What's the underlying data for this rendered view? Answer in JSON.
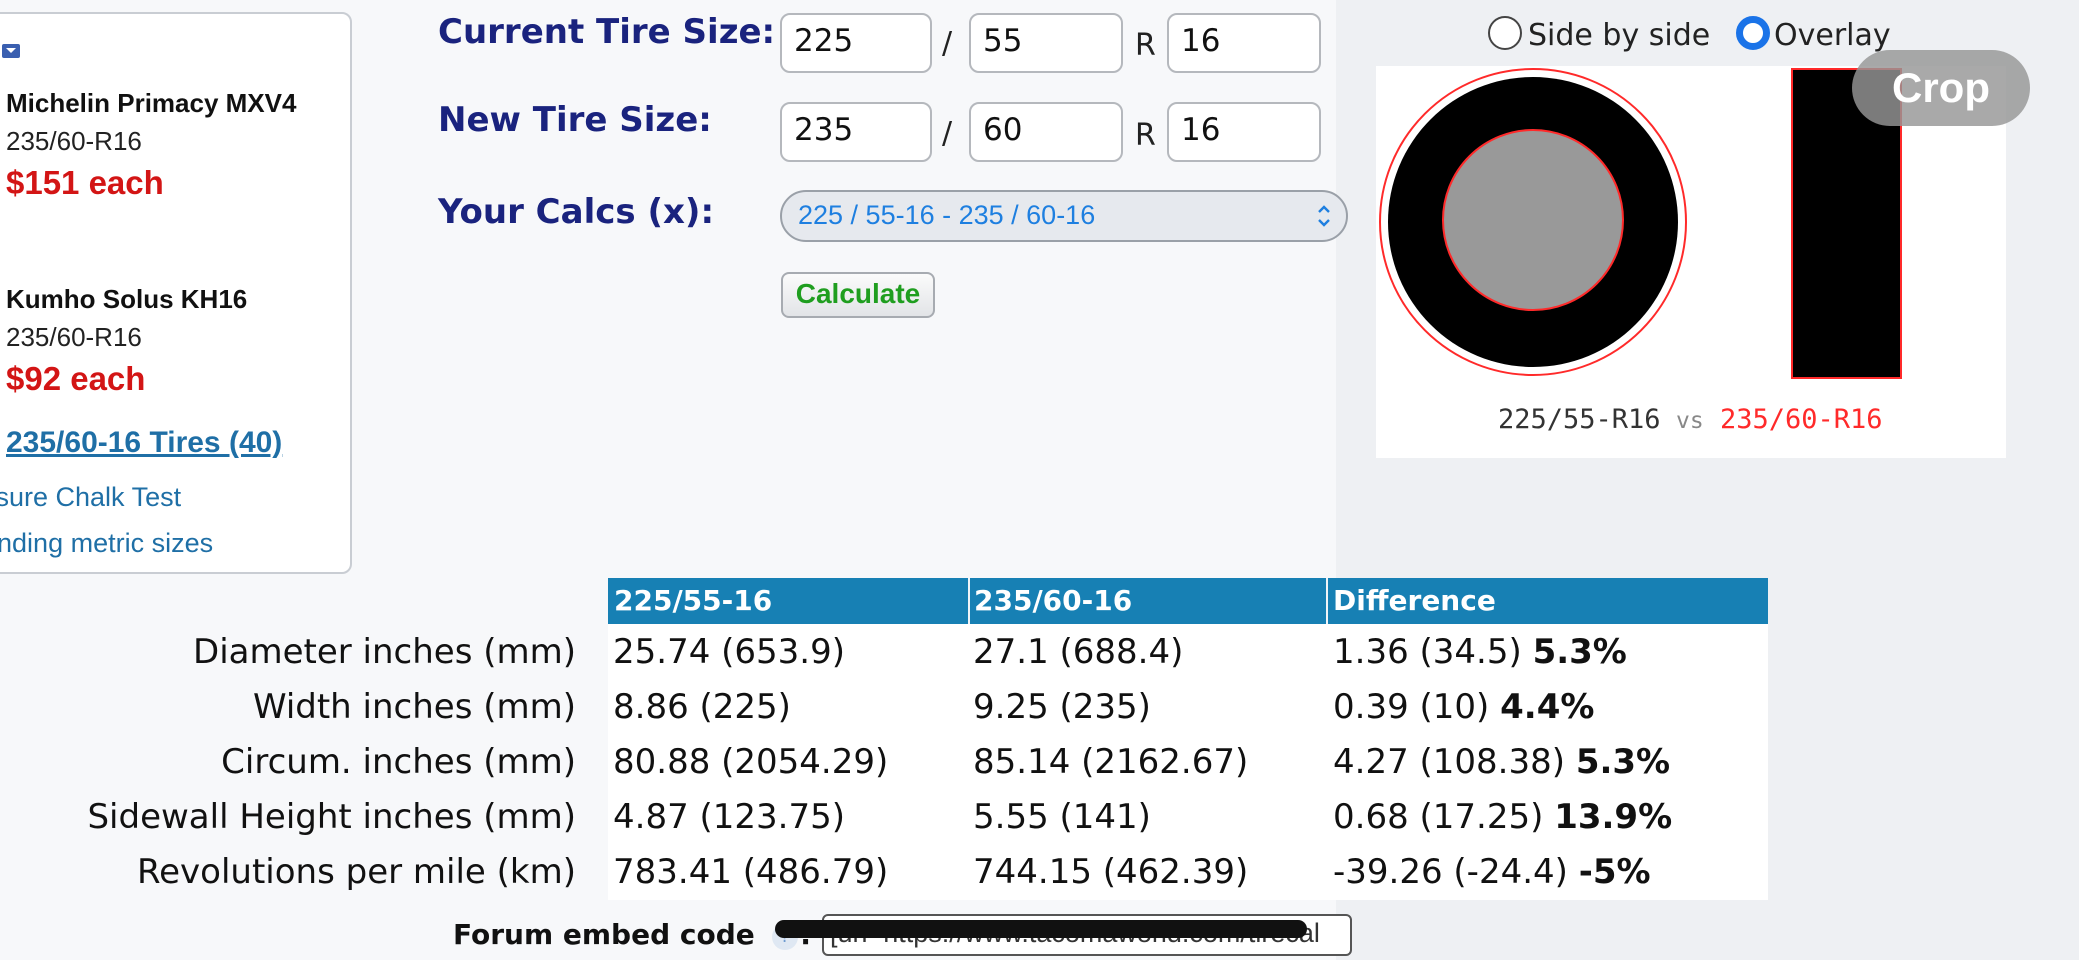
{
  "sidebar": {
    "products": [
      {
        "name": "Michelin Primacy MXV4",
        "size": "235/60-R16",
        "price": "$151 each"
      },
      {
        "name": "Kumho Solus KH16",
        "size": "235/60-R16",
        "price": "$92 each"
      }
    ],
    "tires_link": "235/60-16 Tires (40)",
    "links": [
      "ssure Chalk Test",
      "anding metric sizes"
    ]
  },
  "form": {
    "current_label": "Current Tire Size:",
    "current": {
      "width": "225",
      "ratio": "55",
      "rim": "16"
    },
    "new_label": "New Tire Size:",
    "new": {
      "width": "235",
      "ratio": "60",
      "rim": "16"
    },
    "slash": "/",
    "r": "R",
    "calcs_label": "Your Calcs (x):",
    "calcs_selected": "225 / 55-16 - 235 / 60-16",
    "calculate_label": "Calculate"
  },
  "view_toggle": {
    "side_by_side": "Side by side",
    "overlay": "Overlay",
    "selected": "overlay"
  },
  "crop_label": "Crop",
  "comparison_image": {
    "caption_old": "225/55-R16",
    "caption_vs": "vs",
    "caption_new": "235/60-R16",
    "old_color": "#000000",
    "new_color": "#ff2a2a"
  },
  "table": {
    "headers": [
      "225/55-16",
      "235/60-16",
      "Difference"
    ],
    "rows": [
      {
        "label": "Diameter inches (mm)",
        "old": "25.74 (653.9)",
        "new": "27.1 (688.4)",
        "diff": "1.36 (34.5)",
        "pct": "5.3%"
      },
      {
        "label": "Width inches (mm)",
        "old": "8.86 (225)",
        "new": "9.25 (235)",
        "diff": "0.39 (10)",
        "pct": "4.4%"
      },
      {
        "label": "Circum. inches (mm)",
        "old": "80.88 (2054.29)",
        "new": "85.14 (2162.67)",
        "diff": "4.27 (108.38)",
        "pct": "5.3%"
      },
      {
        "label": "Sidewall Height inches (mm)",
        "old": "4.87 (123.75)",
        "new": "5.55 (141)",
        "diff": "0.68 (17.25)",
        "pct": "13.9%"
      },
      {
        "label": "Revolutions per mile (km)",
        "old": "783.41 (486.79)",
        "new": "744.15 (462.39)",
        "diff": "-39.26 (-24.4)",
        "pct": "-5%"
      }
    ],
    "header_color": "#1780b4"
  },
  "embed": {
    "label": "Forum embed code",
    "help": "?",
    "colon": ":",
    "value": "[url=https://www.tacomaworld.com/tirecal"
  }
}
